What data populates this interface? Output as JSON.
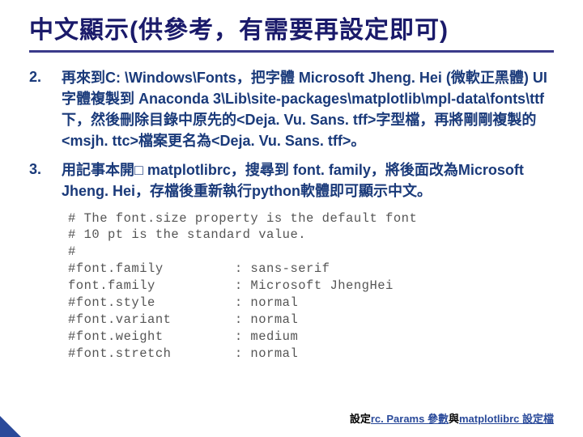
{
  "title": "中文顯示(供參考，有需要再設定即可)",
  "items": [
    {
      "num": "2.",
      "text": "再來到C: \\Windows\\Fonts，把字體 Microsoft Jheng. Hei (微軟正黑體) UI字體複製到 Anaconda 3\\Lib\\site-packages\\matplotlib\\mpl-data\\fonts\\ttf下，然後刪除目錄中原先的<Deja. Vu. Sans. tff>字型檔，再將剛剛複製的<msjh. ttc>檔案更名為<Deja. Vu. Sans. tff>。"
    },
    {
      "num": "3.",
      "text": "用記事本開□ matplotlibrc，搜尋到 font. family，將後面改為Microsoft Jheng. Hei，存檔後重新執行python軟體即可顯示中文。"
    }
  ],
  "code": "# The font.size property is the default font\n# 10 pt is the standard value.\n#\n#font.family         : sans-serif\nfont.family          : Microsoft JhengHei\n#font.style          : normal\n#font.variant        : normal\n#font.weight         : medium\n#font.stretch        : normal",
  "footer": {
    "prefix": "設定",
    "link1": "rc. Params 參數",
    "mid": "與",
    "link2": "matplotlibrc 設定檔"
  }
}
